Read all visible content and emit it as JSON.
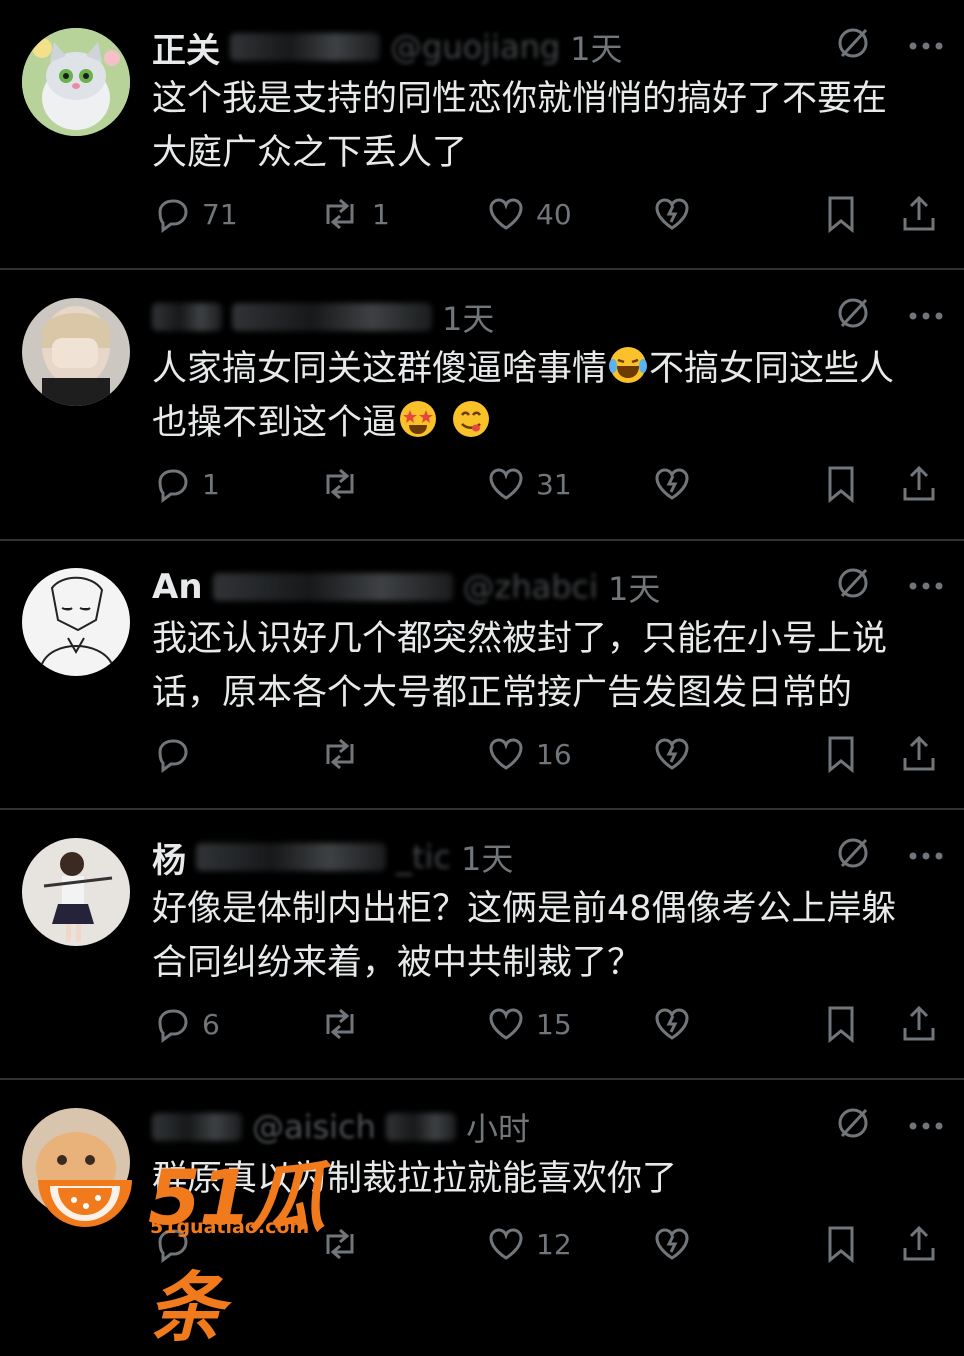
{
  "posts": [
    {
      "name": "正关",
      "handle": "@guojiang",
      "time": "1天",
      "text": "这个我是支持的同性恋你就悄悄的搞好了不要在\n大庭广众之下丢人了",
      "replies": "71",
      "reposts": "1",
      "likes": "40"
    },
    {
      "name": "",
      "handle": "",
      "time": "1天",
      "text_parts": [
        "人家搞女同关这群傻逼啥事情",
        "不搞女同这些人\n也操不到这个逼",
        " "
      ],
      "replies": "1",
      "reposts": "",
      "likes": "31"
    },
    {
      "name": "An",
      "handle": "@zhabci",
      "time": "1天",
      "text": "我还认识好几个都突然被封了，只能在小号上说\n话，原本各个大号都正常接广告发图发日常的",
      "replies": "",
      "reposts": "",
      "likes": "16"
    },
    {
      "name": "杨",
      "handle": "_tic",
      "time": "1天",
      "text": "好像是体制内出柜？这俩是前48偶像考公上岸躲\n合同纠纷来着，被中共制裁了？",
      "replies": "6",
      "reposts": "",
      "likes": "15"
    },
    {
      "name": "",
      "handle": "@aisich",
      "time": "小时",
      "text": "群原真以为制裁拉拉就能喜欢你了",
      "replies": "",
      "reposts": "",
      "likes": "12"
    }
  ],
  "watermark": {
    "logo_text": "51瓜条",
    "url": "51guatiao.com"
  },
  "colors": {
    "background": "#000000",
    "text": "#e7e9ea",
    "muted": "#71767b",
    "divider": "#2f3336",
    "watermark": "#f07a1c"
  }
}
